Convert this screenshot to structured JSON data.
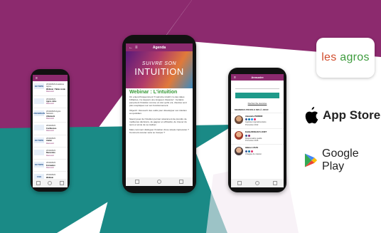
{
  "brand": {
    "name": "les agros"
  },
  "stores": {
    "apple": "App Store",
    "google": "Google Play"
  },
  "colors": {
    "magenta": "#8c2a6e",
    "teal": "#1a8a86",
    "lightPink": "#f3eaf2",
    "green": "#3a9a3a"
  },
  "left_phone": {
    "items": [
      {
        "logo": "OCTOPE",
        "date": "26/10/2023 Académie Agros...",
        "title": "Webinar / Table ronde",
        "tag": "Découvrir"
      },
      {
        "logo": "",
        "date": "26/10/2023",
        "title": "Agros Jobs",
        "tag": "Découvrir"
      },
      {
        "logo": "UNOBRAIN",
        "date": "26/10/2023 Agros Network...",
        "title": "Afterwork",
        "tag": "Découvrir"
      },
      {
        "logo": "",
        "date": "26/10/2023",
        "title": "Conférence",
        "tag": "Découvrir"
      },
      {
        "logo": "OCTOPE",
        "date": "26/10/2023",
        "title": "Atelier",
        "tag": "Découvrir"
      },
      {
        "logo": "",
        "date": "26/10/2023",
        "title": "Rencontre",
        "tag": "Découvrir"
      },
      {
        "logo": "OCTOPE",
        "date": "26/10/2023",
        "title": "Formation",
        "tag": "Découvrir"
      },
      {
        "logo": "CGE",
        "date": "26/10/2023",
        "title": "Webinar",
        "tag": "Découvrir"
      }
    ]
  },
  "center_phone": {
    "title": "Agenda",
    "hero_line1": "SUIVRE SON",
    "hero_line2": "INTUITION",
    "webinar_title": "Webinar : L'intuition",
    "paragraphs": [
      "On entend fréquemment \"il sait être intuitif, il a des idées brillantes, il a toujours une longueur d'avance\". Certains perçoivent l'intuition comme un don qu'ils ont, d'autres sont plus sceptiques sur son fonctionnement.",
      "Objectif : Découvrir des outils pour développer son intuition au quotidien.",
      "Savoir jouer de l'intuition permet notamment de prendre de meilleures décisions, de gagner en efficacité, de trouver du sens et envie de se réaliser.",
      "Mais comment distinguer l'intuition d'une simple impression ? Comment écouter sans se tromper ?"
    ]
  },
  "right_phone": {
    "title": "Annuaire",
    "link": "Recherche avancée",
    "section": "MEMBRES PROFILS MIS À JOUR",
    "members": [
      {
        "name": "Alexandre PERNOD",
        "line": "Ingénieur Agroalimentaire",
        "year": "Promotion 2012"
      },
      {
        "name": "Emilia RENAULT-LOUET",
        "line": "Responsable qualité",
        "year": "Promotion 2016"
      },
      {
        "name": "Hélène LUCAS",
        "line": "Chargée de mission",
        "year": "Promotion 2019"
      }
    ]
  }
}
